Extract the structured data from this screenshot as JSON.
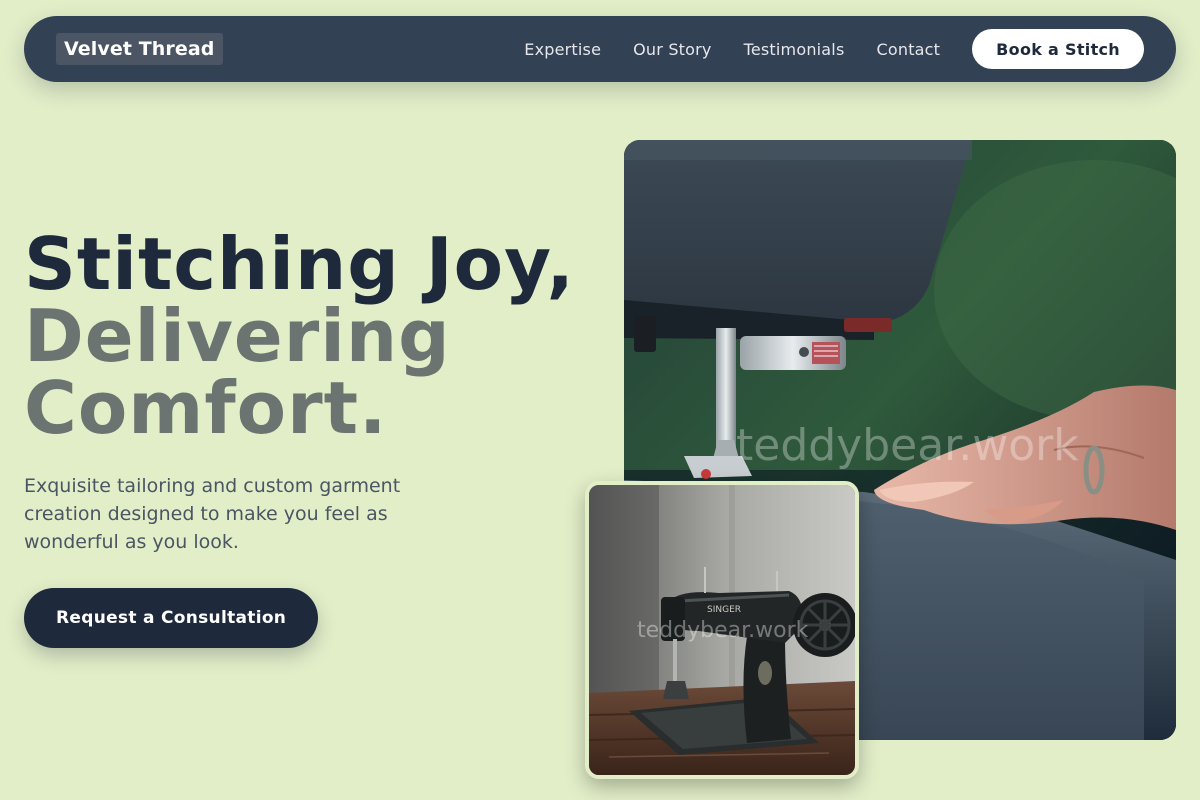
{
  "nav": {
    "brand": "Velvet Thread",
    "links": [
      "Expertise",
      "Our Story",
      "Testimonials",
      "Contact"
    ],
    "cta_label": "Book a Stitch"
  },
  "hero": {
    "title_line1": "Stitching Joy,",
    "title_line2": "Delivering",
    "title_line3": "Comfort.",
    "subtitle": "Exquisite tailoring and custom garment creation designed to make you feel as wonderful as you look.",
    "cta_label": "Request a Consultation"
  },
  "images": {
    "main": {
      "subject": "sewing machine needle with hands guiding grey fabric",
      "watermark": "teddybear.work"
    },
    "inset": {
      "subject": "vintage black Singer sewing machine on wooden table",
      "brand_text": "SINGER",
      "watermark": "teddybear.work"
    }
  },
  "colors": {
    "background": "#e2eec8",
    "nav_background": "#334155",
    "primary_dark": "#1e293b",
    "muted_title": "#6b7470",
    "body_text": "#4b5563"
  }
}
